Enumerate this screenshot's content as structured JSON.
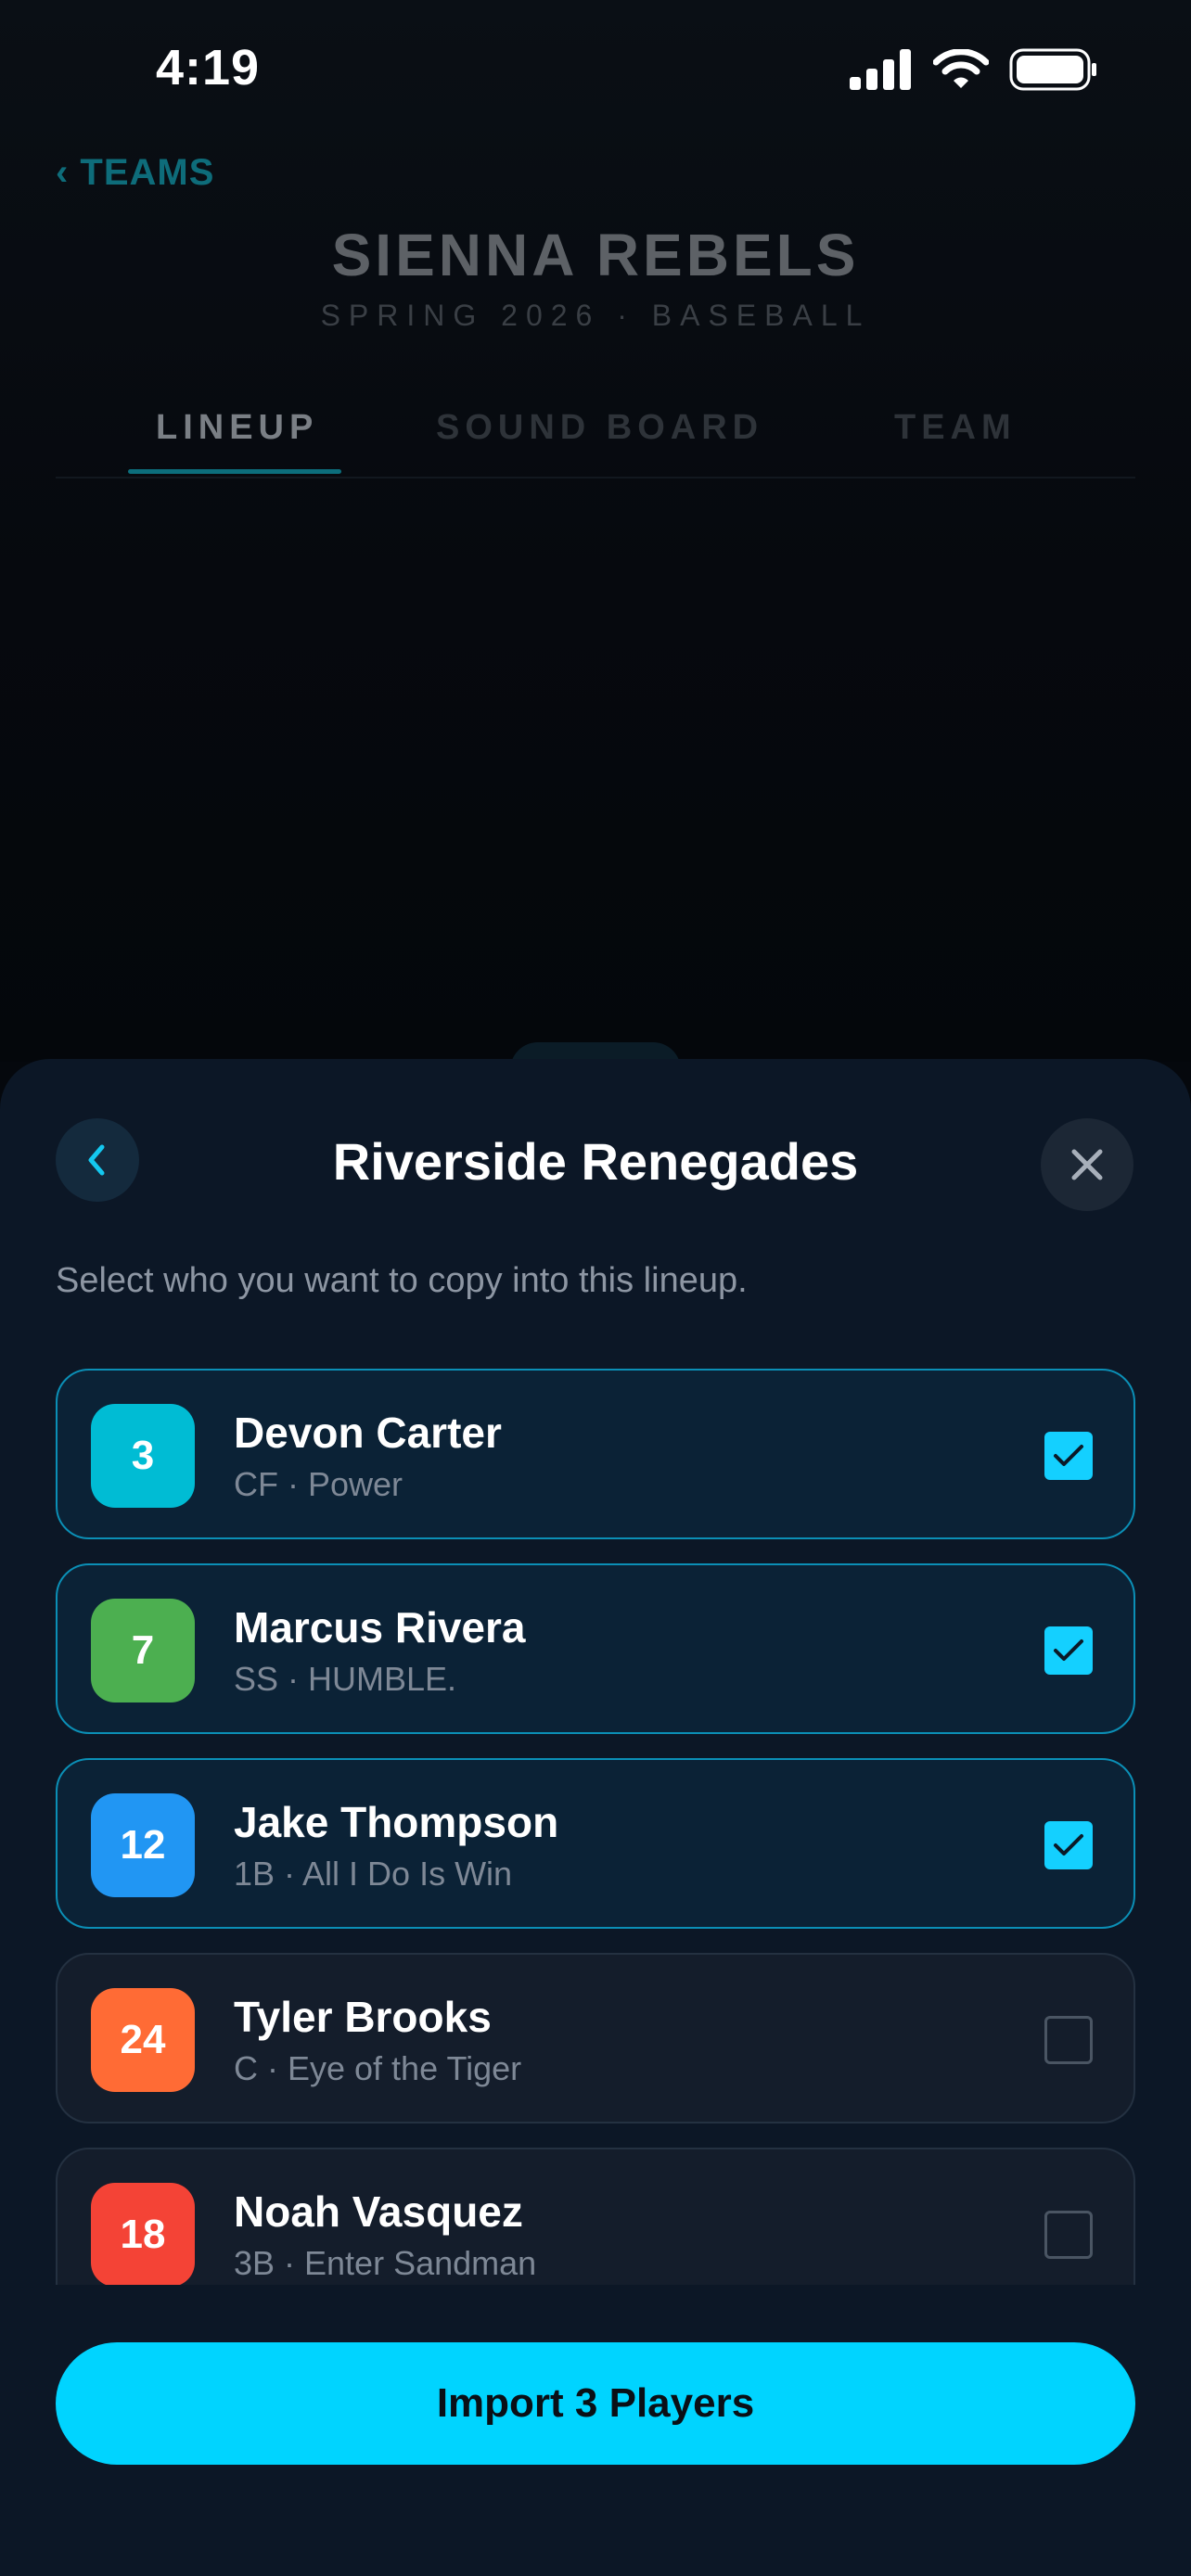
{
  "status_bar": {
    "time": "4:19"
  },
  "header": {
    "back_label": "‹ TEAMS",
    "team_name": "SIENNA REBELS",
    "season": "SPRING 2026 · BASEBALL"
  },
  "tabs": [
    {
      "label": "LINEUP",
      "active": true
    },
    {
      "label": "SOUND BOARD",
      "active": false
    },
    {
      "label": "TEAM",
      "active": false
    }
  ],
  "sheet": {
    "title": "Riverside Renegades",
    "instructions": "Select who you want to copy into this lineup.",
    "players": [
      {
        "number": "3",
        "name": "Devon Carter",
        "meta": "CF · Power",
        "color": "#00bcd4",
        "selected": true
      },
      {
        "number": "7",
        "name": "Marcus Rivera",
        "meta": "SS · HUMBLE.",
        "color": "#4caf50",
        "selected": true
      },
      {
        "number": "12",
        "name": "Jake Thompson",
        "meta": "1B · All I Do Is Win",
        "color": "#2196f3",
        "selected": true
      },
      {
        "number": "24",
        "name": "Tyler Brooks",
        "meta": "C · Eye of the Tiger",
        "color": "#ff6b35",
        "selected": false
      },
      {
        "number": "18",
        "name": "Noah Vasquez",
        "meta": "3B · Enter Sandman",
        "color": "#f44336",
        "selected": false
      }
    ],
    "import_label": "Import 3 Players"
  },
  "colors": {
    "accent": "#00d4ff",
    "selected_border": "#0b8fb6"
  }
}
